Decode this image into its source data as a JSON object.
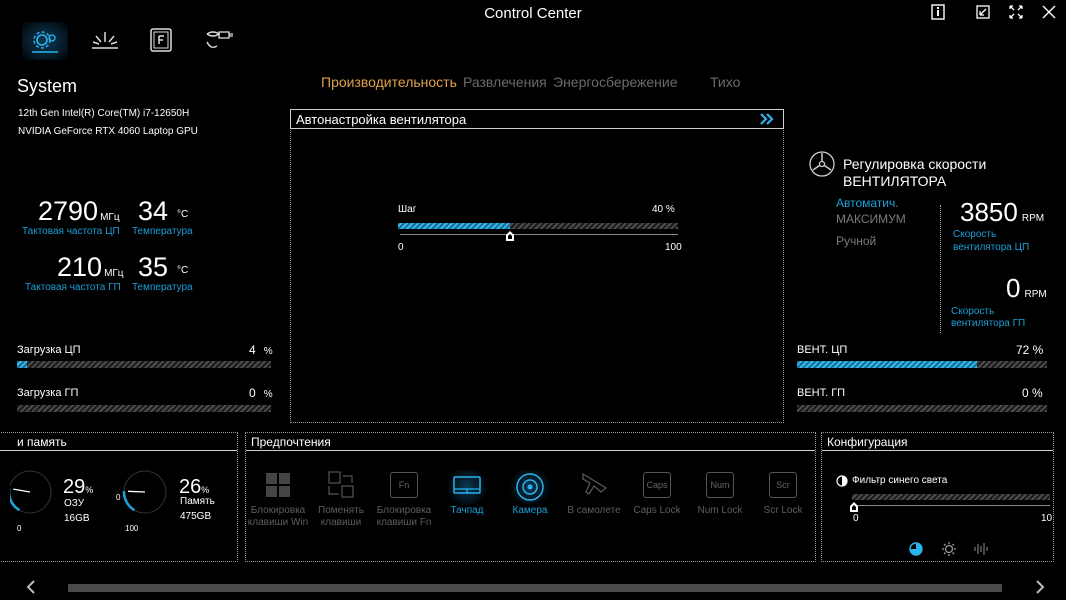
{
  "window": {
    "title": "Control Center"
  },
  "toolbar_icons": [
    "gear-laptop-icon",
    "light-rays-icon",
    "f-key-icon",
    "plug-icon"
  ],
  "window_controls": [
    "info-icon",
    "restore-icon",
    "fullscreen-icon",
    "close-icon"
  ],
  "system": {
    "title": "System",
    "cpu_name": "12th Gen Intel(R) Core(TM) i7-12650H",
    "gpu_name": "NVIDIA GeForce RTX 4060 Laptop GPU",
    "cpu_freq": {
      "value": "2790",
      "unit": "МГц",
      "label": "Тактовая частота ЦП"
    },
    "cpu_temp": {
      "value": "34",
      "unit": "°C",
      "label": "Температура"
    },
    "gpu_freq": {
      "value": "210",
      "unit": "МГц",
      "label": "Тактовая частота ГП"
    },
    "gpu_temp": {
      "value": "35",
      "unit": "°C",
      "label": "Температура"
    },
    "cpu_load": {
      "label": "Загрузка ЦП",
      "value": "4",
      "unit": "%",
      "percent": 4
    },
    "gpu_load": {
      "label": "Загрузка ГП",
      "value": "0",
      "unit": "%",
      "percent": 0
    }
  },
  "modes": [
    {
      "label": "Производительность",
      "active": true
    },
    {
      "label": "Развлечения",
      "active": false
    },
    {
      "label": "Энергосбережение",
      "active": false
    },
    {
      "label": "Тихо",
      "active": false
    }
  ],
  "fan_auto": {
    "title": "Автонастройка вентилятора",
    "step_label": "Шаг",
    "step_value": "40 %",
    "percent": 40,
    "min": "0",
    "max": "100"
  },
  "fan_speed": {
    "title_line1": "Регулировка скорости",
    "title_line2": "ВЕНТИЛЯТОРА",
    "options": [
      "Автоматич.",
      "МАКСИМУМ",
      "Ручной"
    ],
    "cpu_rpm": "3850",
    "gpu_rpm": "0",
    "rpm_unit": "RPM",
    "cpu_label_1": "Скорость",
    "cpu_label_2": "вентилятора ЦП",
    "gpu_label_1": "Скорость",
    "gpu_label_2": "вентилятора ГП",
    "cpu_fan": {
      "label": "ВЕНТ. ЦП",
      "value": "72 %",
      "percent": 72
    },
    "gpu_fan": {
      "label": "ВЕНТ. ГП",
      "value": "0 %",
      "percent": 0
    }
  },
  "memory": {
    "title": "и память",
    "ram_percent": "29",
    "ram_label": "ОЗУ",
    "ram_size": "16GB",
    "disk_percent": "26",
    "disk_label": "Память",
    "disk_size": "475GB",
    "pct": "%",
    "gauge_min": "0",
    "gauge_max": "100",
    "ram_fraction": 0.29,
    "disk_fraction": 0.26
  },
  "preferences": {
    "title": "Предпочтения",
    "items": [
      {
        "label_1": "Блокировка",
        "label_2": "клавиши Win",
        "icon": "windows-key-icon",
        "active": false
      },
      {
        "label_1": "Поменять",
        "label_2": "клавиши",
        "icon": "swap-keys-icon",
        "active": false
      },
      {
        "label_1": "Блокировка",
        "label_2": "клавиши Fn",
        "icon": "fn-key-icon",
        "key": "Fn",
        "active": false
      },
      {
        "label_1": "Тачпад",
        "label_2": "",
        "icon": "touchpad-icon",
        "active": true
      },
      {
        "label_1": "Камера",
        "label_2": "",
        "icon": "camera-icon",
        "active": true
      },
      {
        "label_1": "В самолете",
        "label_2": "",
        "icon": "airplane-icon",
        "active": false
      },
      {
        "label_1": "Caps Lock",
        "label_2": "",
        "icon": "caps-lock-icon",
        "key": "Caps",
        "active": false
      },
      {
        "label_1": "Num Lock",
        "label_2": "",
        "icon": "num-lock-icon",
        "key": "Num",
        "active": false
      },
      {
        "label_1": "Scr Lock",
        "label_2": "",
        "icon": "scroll-lock-icon",
        "key": "Scr",
        "active": false
      }
    ]
  },
  "configuration": {
    "title": "Конфигурация",
    "blue_light_label": "Фильтр синего света",
    "min": "0",
    "max": "10",
    "value": 0,
    "modes": [
      "moon-mode-icon",
      "sun-mode-icon",
      "waveform-icon"
    ]
  },
  "colors": {
    "accent": "#1c9fd8",
    "active_tab": "#e0a24a",
    "background": "#000000"
  }
}
